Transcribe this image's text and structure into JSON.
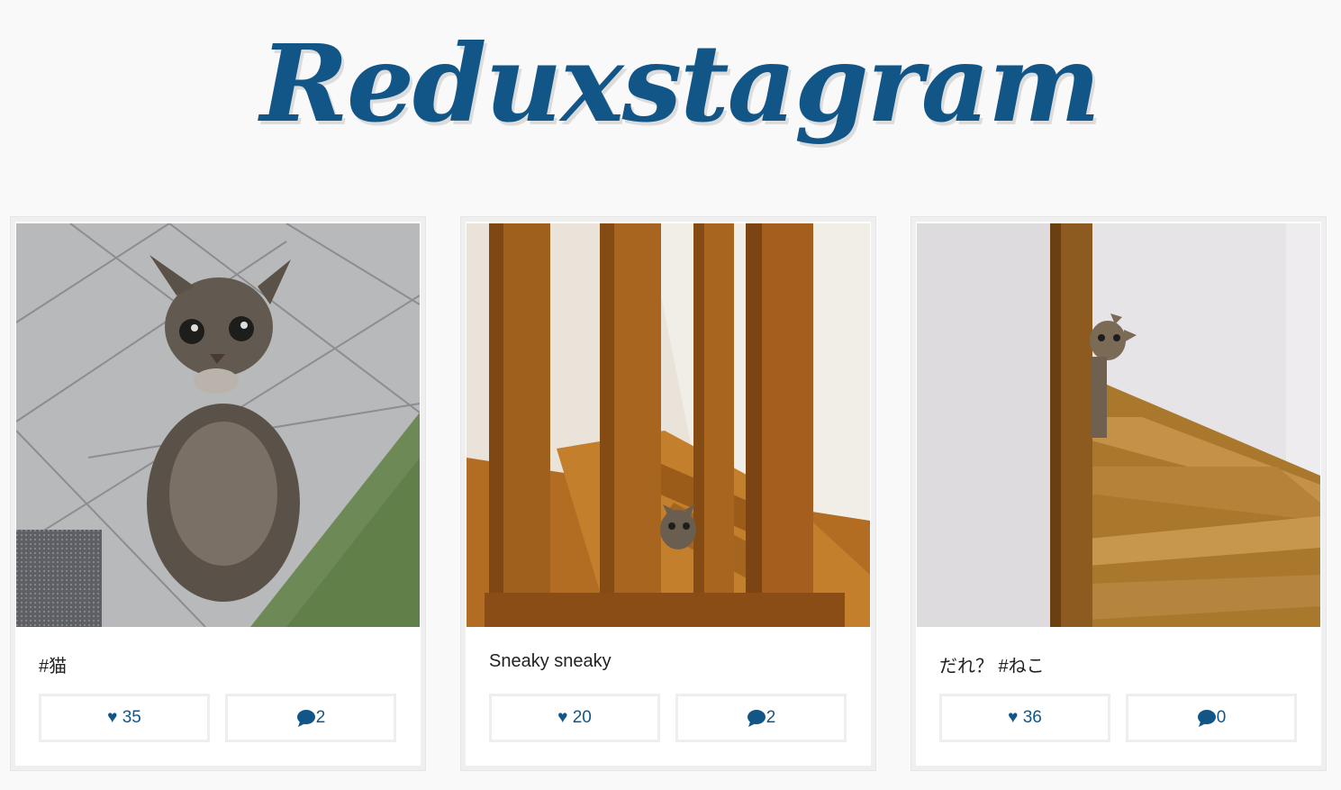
{
  "app": {
    "title": "Reduxstagram"
  },
  "posts": [
    {
      "caption": "#猫",
      "likes_label": "♥ 35",
      "comments": "2",
      "image": "cat-on-tiles"
    },
    {
      "caption": "Sneaky sneaky",
      "likes_label": "♥ 20",
      "comments": "2",
      "image": "cat-behind-stair-bars"
    },
    {
      "caption": "だれ？ #ねこ",
      "likes_label": "♥ 36",
      "comments": "0",
      "image": "cat-peeking-on-stairs"
    }
  ],
  "colors": {
    "brand": "#125688",
    "background": "#f9f9f9",
    "border": "#eeeeee"
  },
  "icons": {
    "heart": "heart-icon",
    "comment": "comment-bubble-icon"
  }
}
